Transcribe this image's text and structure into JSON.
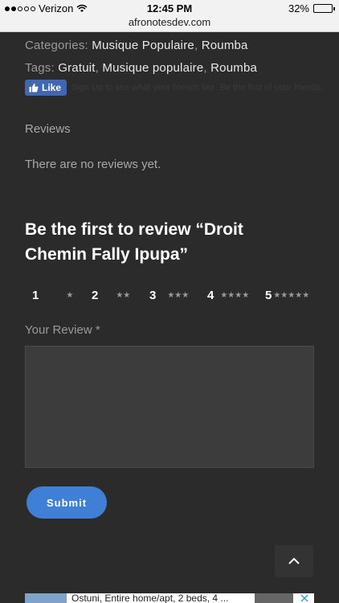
{
  "status": {
    "carrier": "Verizon",
    "time": "12:45 PM",
    "battery": "32%",
    "battery_level": 0.32,
    "url": "afronotesdev.com"
  },
  "meta": {
    "categories_label": "Categories:",
    "categories": [
      "Musique Populaire",
      "Roumba"
    ],
    "tags_label": "Tags:",
    "tags": [
      "Gratuit",
      "Musique populaire",
      "Roumba"
    ]
  },
  "social": {
    "like_label": "Like",
    "like_text": "Sign Up to see what your friends like. Be the first of your friends."
  },
  "reviews": {
    "tab_label": "Reviews",
    "empty_text": "There are no reviews yet.",
    "form_title": "Be the first to review “Droit Chemin Fally Ipupa”",
    "rating_options": [
      {
        "number": "1",
        "stars": "★"
      },
      {
        "number": "2",
        "stars": "★★"
      },
      {
        "number": "3",
        "stars": "★★★"
      },
      {
        "number": "4",
        "stars": "★★★★"
      },
      {
        "number": "5",
        "stars": "★★★★★"
      }
    ],
    "your_review_label": "Your Review *",
    "submit_label": "Submit"
  },
  "ad": {
    "text": "Ostuni, Entire home/apt, 2 beds, 4 ..."
  },
  "icons": {
    "wifi": "wifi-icon",
    "like_thumb": "thumbs-up-icon",
    "scroll_top": "chevron-up-icon",
    "ad_close": "close-icon"
  },
  "colors": {
    "background": "#2b2b2b",
    "link": "#e8e8e8",
    "muted": "#9a9a9a",
    "accent": "#3f7fd6",
    "facebook": "#4267b2"
  }
}
